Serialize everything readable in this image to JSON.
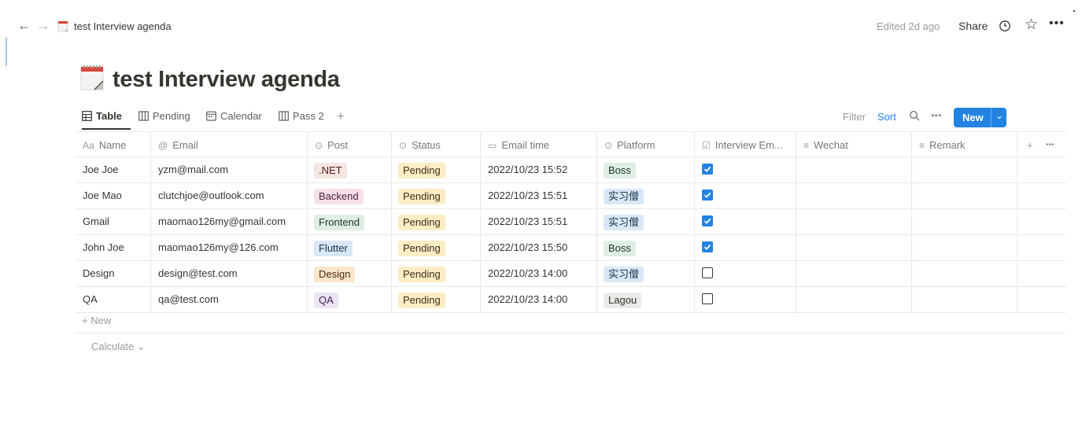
{
  "topbar": {
    "back_arrow": "←",
    "forward_arrow": "→",
    "breadcrumb_title": "test Interview agenda",
    "edited": "Edited 2d ago",
    "share_label": "Share",
    "star": "☆",
    "more": "•••"
  },
  "page": {
    "title": "test Interview agenda",
    "icon": "calendar-icon"
  },
  "views": [
    {
      "label": "Table",
      "icon": "table-icon",
      "active": true
    },
    {
      "label": "Pending",
      "icon": "board-icon"
    },
    {
      "label": "Calendar",
      "icon": "calendar-view-icon"
    },
    {
      "label": "Pass 2",
      "icon": "board-icon"
    }
  ],
  "view_add": "+",
  "toolbar": {
    "filter_label": "Filter",
    "sort_label": "Sort",
    "more": "•••",
    "new_label": "New",
    "new_chevron": "⌄"
  },
  "columns": [
    {
      "label": "Name",
      "icon": "Aa"
    },
    {
      "label": "Email",
      "icon": "@"
    },
    {
      "label": "Post",
      "icon": "⊙"
    },
    {
      "label": "Status",
      "icon": "⊙"
    },
    {
      "label": "Email time",
      "icon": "▭"
    },
    {
      "label": "Platform",
      "icon": "⊙"
    },
    {
      "label": "Interview Em...",
      "icon": "☑"
    },
    {
      "label": "Wechat",
      "icon": "≡"
    },
    {
      "label": "Remark",
      "icon": "≡"
    }
  ],
  "column_actions": {
    "add": "+",
    "more": "•••"
  },
  "rows": [
    {
      "name": "Joe Joe",
      "email": "yzm@mail.com",
      "post": ".NET",
      "status": "Pending",
      "email_time": "2022/10/23 15:52",
      "platform": "Boss",
      "interview": true
    },
    {
      "name": "Joe Mao",
      "email": "clutchjoe@outlook.com",
      "post": "Backend",
      "status": "Pending",
      "email_time": "2022/10/23 15:51",
      "platform": "实习僧",
      "interview": true
    },
    {
      "name": "Gmail",
      "email": "maomao126my@gmail.com",
      "post": "Frontend",
      "status": "Pending",
      "email_time": "2022/10/23 15:51",
      "platform": "实习僧",
      "interview": true
    },
    {
      "name": "John Joe",
      "email": "maomao126my@126.com",
      "post": "Flutter",
      "status": "Pending",
      "email_time": "2022/10/23 15:50",
      "platform": "Boss",
      "interview": true
    },
    {
      "name": "Design",
      "email": "design@test.com",
      "post": "Design",
      "status": "Pending",
      "email_time": "2022/10/23 14:00",
      "platform": "实习僧",
      "interview": false
    },
    {
      "name": "QA",
      "email": "qa@test.com",
      "post": "QA",
      "status": "Pending",
      "email_time": "2022/10/23 14:00",
      "platform": "Lagou",
      "interview": false
    }
  ],
  "tag_colors": {
    ".NET": {
      "bg": "#f4e6e1",
      "fg": "#5d1715"
    },
    "Backend": {
      "bg": "#f6e1ea",
      "fg": "#4c2337"
    },
    "Frontend": {
      "bg": "#dfeee3",
      "fg": "#1c3829"
    },
    "Flutter": {
      "bg": "#d9e8f6",
      "fg": "#183347"
    },
    "Design": {
      "bg": "#fbe5cc",
      "fg": "#49290e"
    },
    "QA": {
      "bg": "#ece3f5",
      "fg": "#412454"
    },
    "Pending": {
      "bg": "#fbedc4",
      "fg": "#402c1b"
    },
    "Boss": {
      "bg": "#dfeee3",
      "fg": "#1c3829"
    },
    "实习僧": {
      "bg": "#d9e8f6",
      "fg": "#183347"
    },
    "Lagou": {
      "bg": "#ebeae8",
      "fg": "#32302c"
    }
  },
  "add_row_label": "+ New",
  "calculate_label": "Calculate ⌄"
}
